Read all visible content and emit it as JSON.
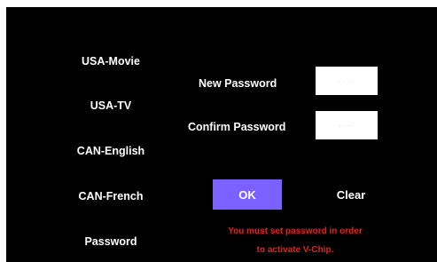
{
  "menu": {
    "items": [
      {
        "label": "USA-Movie"
      },
      {
        "label": "USA-TV"
      },
      {
        "label": "CAN-English"
      },
      {
        "label": "CAN-French"
      },
      {
        "label": "Password"
      }
    ]
  },
  "form": {
    "new_password_label": "New Password",
    "new_password_value": "····",
    "confirm_password_label": "Confirm Password",
    "confirm_password_value": "····"
  },
  "buttons": {
    "ok_label": "OK",
    "clear_label": "Clear"
  },
  "message": {
    "line1": "You  must set password  in order",
    "line2": "to activate V-Chip."
  },
  "colors": {
    "background": "#000000",
    "ok_button": "#7b61ff",
    "message_text": "#e0241b"
  }
}
